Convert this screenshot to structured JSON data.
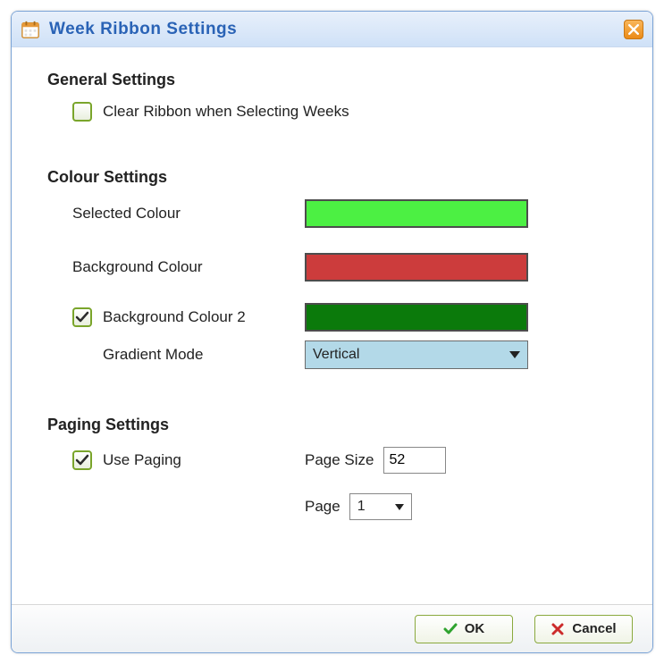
{
  "dialog": {
    "title": "Week Ribbon Settings"
  },
  "sections": {
    "general": {
      "header": "General Settings",
      "clear_ribbon_label": "Clear Ribbon when Selecting Weeks",
      "clear_ribbon_checked": false
    },
    "colour": {
      "header": "Colour Settings",
      "selected_label": "Selected Colour",
      "selected_value": "#4cf043",
      "background_label": "Background Colour",
      "background_value": "#cc3c3c",
      "background2_label": "Background Colour 2",
      "background2_checked": true,
      "background2_value": "#0b7a0b",
      "gradient_label": "Gradient Mode",
      "gradient_value": "Vertical"
    },
    "paging": {
      "header": "Paging Settings",
      "use_paging_label": "Use Paging",
      "use_paging_checked": true,
      "page_size_label": "Page Size",
      "page_size_value": "52",
      "page_label": "Page",
      "page_value": "1"
    }
  },
  "footer": {
    "ok": "OK",
    "cancel": "Cancel"
  }
}
